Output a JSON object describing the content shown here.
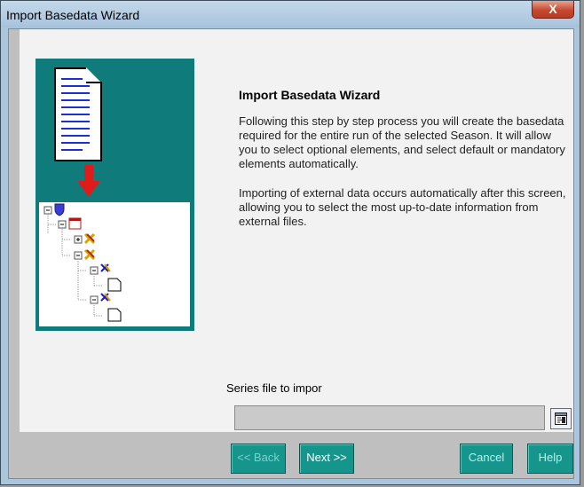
{
  "window": {
    "title": "Import Basedata Wizard",
    "close_glyph": "X",
    "close_icon": "close-icon"
  },
  "main": {
    "heading": "Import Basedata Wizard",
    "paragraph1": "Following this step by step  process you will create the basedata required for the entire run of the selected Season. It will allow you to select optional elements, and select default or mandatory elements automatically.",
    "paragraph2": "Importing of external data occurs automatically after this screen, allowing you to select the most up-to-date information from external files.",
    "illustration_icons": [
      "document-icon",
      "red-arrow-down-icon",
      "tree-view-icon"
    ]
  },
  "series": {
    "label": "Series file to impor",
    "value": "",
    "browse_icon": "browse-file-icon"
  },
  "buttons": {
    "back": "<< Back",
    "next": "Next >>",
    "cancel": "Cancel",
    "help": "Help"
  },
  "colors": {
    "teal": "#0f7b7b",
    "button_teal": "#16958d",
    "close_red": "#c64a2f",
    "doc_lines": "#1a2fd6"
  }
}
